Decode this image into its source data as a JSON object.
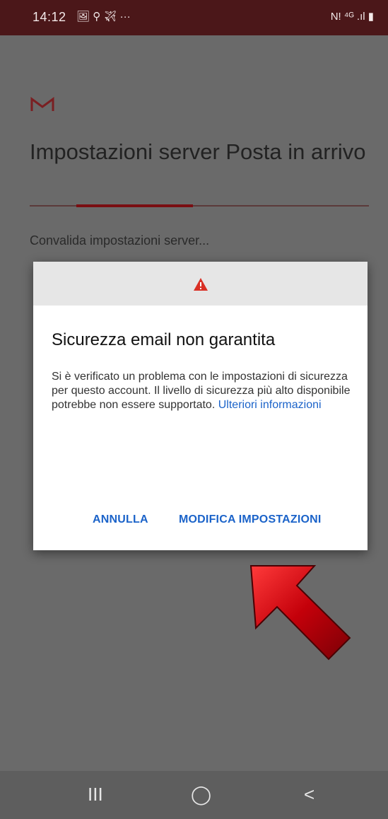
{
  "status_bar": {
    "time": "14:12",
    "left_icons": "🖼 ⚲ ✈ ···",
    "right_icons": "N! ⁴ᴳ .ıl ▮"
  },
  "setup": {
    "title": "Impostazioni server Posta in arrivo",
    "status_message": "Convalida impostazioni server..."
  },
  "dialog": {
    "title": "Sicurezza email non garantita",
    "body": "Si è verificato un problema con le impostazioni di sicurezza per questo account. Il livello di sicurezza più alto disponibile potrebbe non essere supportato.",
    "link": "Ulteriori informazioni",
    "cancel_label": "ANNULLA",
    "modify_label": "MODIFICA IMPOSTAZIONI"
  },
  "nav_bar": {
    "recent": "III",
    "home": "◯",
    "back": "<"
  },
  "colors": {
    "status_bar": "#4b1719",
    "accent_blue": "#1b63c9",
    "warning_red": "#d93025",
    "arrow_red": "#c4000a"
  }
}
